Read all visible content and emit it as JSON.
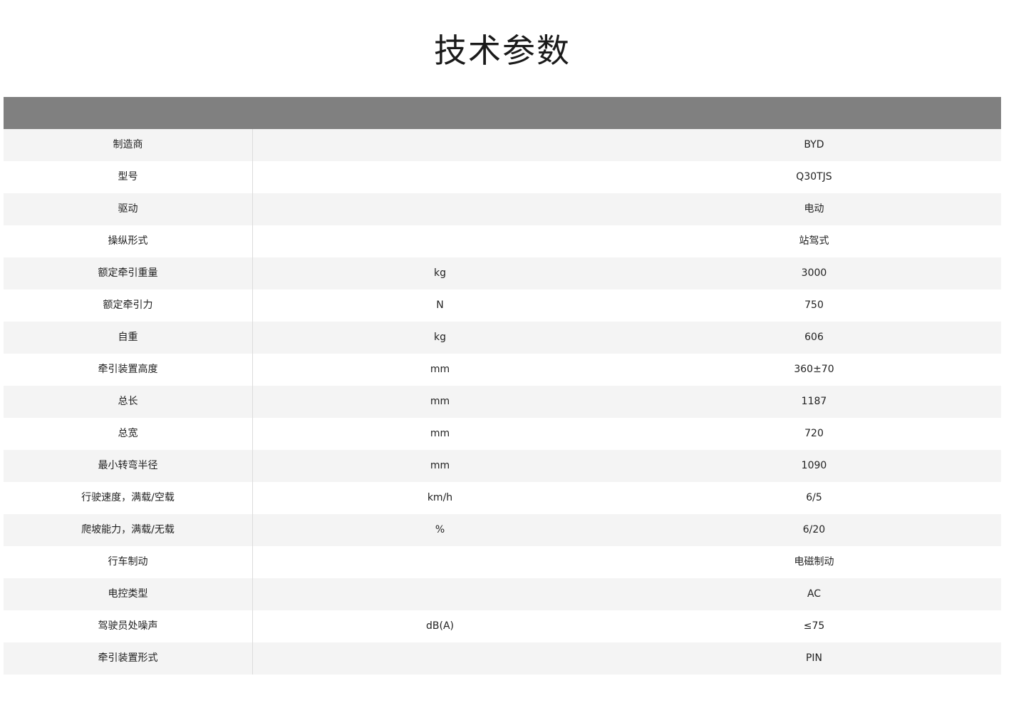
{
  "page": {
    "title": "技术参数"
  },
  "table": {
    "rows": [
      {
        "name": "制造商",
        "unit": "",
        "value": "BYD"
      },
      {
        "name": "型号",
        "unit": "",
        "value": "Q30TJS"
      },
      {
        "name": "驱动",
        "unit": "",
        "value": "电动"
      },
      {
        "name": "操纵形式",
        "unit": "",
        "value": "站驾式"
      },
      {
        "name": "额定牵引重量",
        "unit": "kg",
        "value": "3000"
      },
      {
        "name": "额定牵引力",
        "unit": "N",
        "value": "750"
      },
      {
        "name": "自重",
        "unit": "kg",
        "value": "606"
      },
      {
        "name": "牵引装置高度",
        "unit": "mm",
        "value": "360±70"
      },
      {
        "name": "总长",
        "unit": "mm",
        "value": "1187"
      },
      {
        "name": "总宽",
        "unit": "mm",
        "value": "720"
      },
      {
        "name": "最小转弯半径",
        "unit": "mm",
        "value": "1090"
      },
      {
        "name": "行驶速度，满载/空载",
        "unit": "km/h",
        "value": "6/5"
      },
      {
        "name": "爬坡能力，满载/无载",
        "unit": "%",
        "value": "6/20"
      },
      {
        "name": "行车制动",
        "unit": "",
        "value": "电磁制动"
      },
      {
        "name": "电控类型",
        "unit": "",
        "value": "AC"
      },
      {
        "name": "驾驶员处噪声",
        "unit": "dB(A)",
        "value": "≤75"
      },
      {
        "name": "牵引装置形式",
        "unit": "",
        "value": "PIN"
      }
    ]
  },
  "colors": {
    "header_bar": "#808080",
    "row_alt": "#f4f4f4",
    "row_base": "#ffffff"
  }
}
